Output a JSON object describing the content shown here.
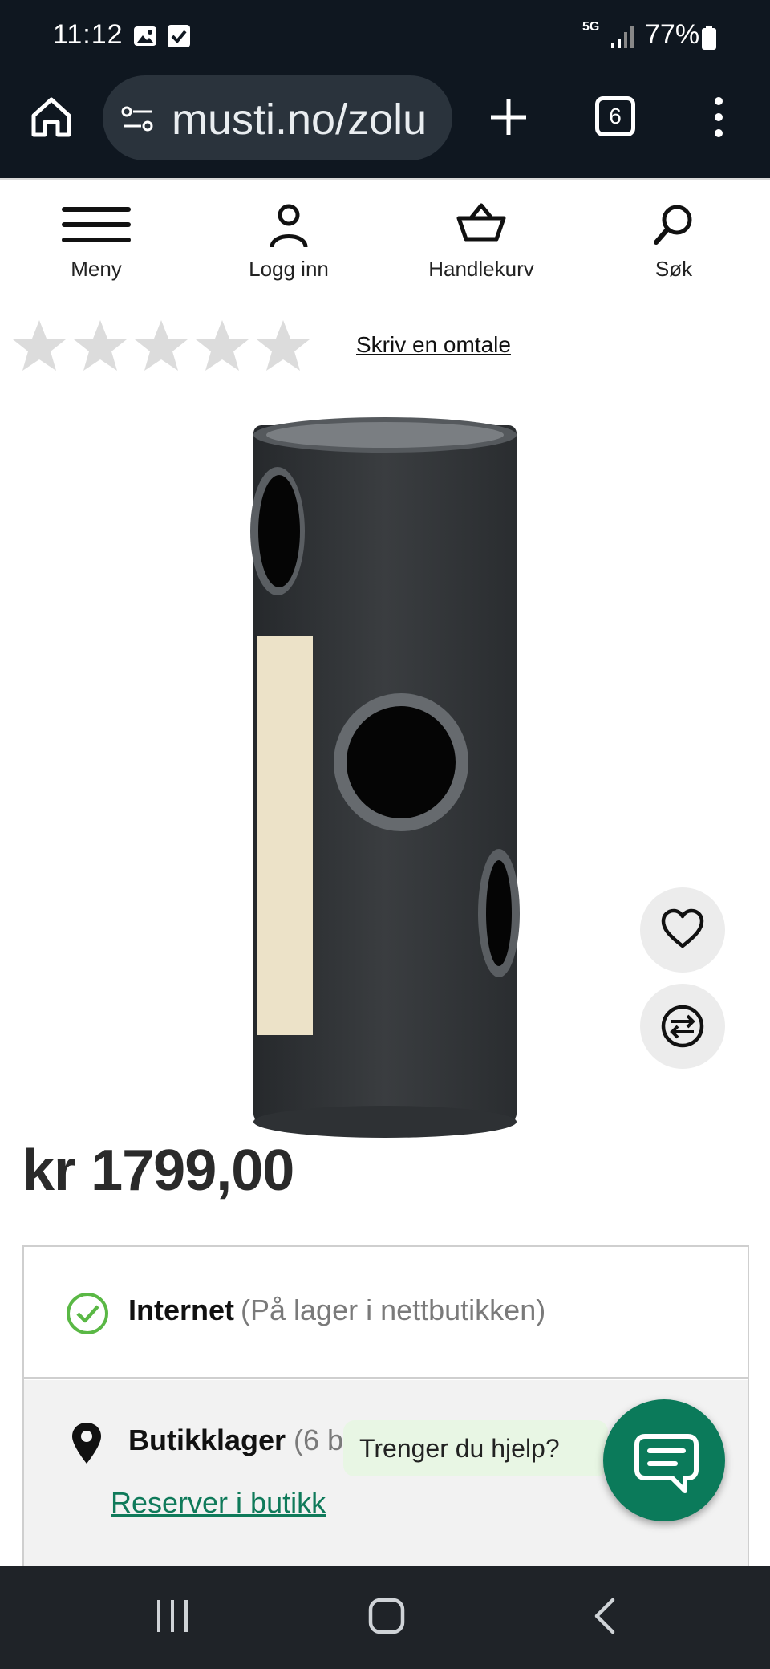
{
  "status_bar": {
    "time": "11:12",
    "network": "5G",
    "battery": "77%"
  },
  "browser": {
    "url": "musti.no/zolu",
    "tab_count": "6"
  },
  "site_nav": {
    "items": [
      {
        "label": "Meny",
        "icon": "hamburger-icon"
      },
      {
        "label": "Logg inn",
        "icon": "user-icon"
      },
      {
        "label": "Handlekurv",
        "icon": "basket-icon"
      },
      {
        "label": "Søk",
        "icon": "search-icon"
      }
    ]
  },
  "rating": {
    "stars_filled": 0,
    "stars_total": 5,
    "review_link": "Skriv en omtale"
  },
  "product": {
    "price": "kr 1799,00"
  },
  "availability": {
    "online": {
      "label": "Internet",
      "status": "(På lager i nettbutikken)"
    },
    "store": {
      "label": "Butikklager",
      "count": "(6 b",
      "reserve_link": "Reserver i butikk"
    }
  },
  "chat": {
    "prompt": "Trenger du hjelp?"
  },
  "colors": {
    "dark_bar": "#0f1720",
    "accent_green": "#0b7a5a",
    "link_green": "#0f7a5a",
    "check_green": "#5ab845",
    "star_gray": "#dcdcdc"
  }
}
